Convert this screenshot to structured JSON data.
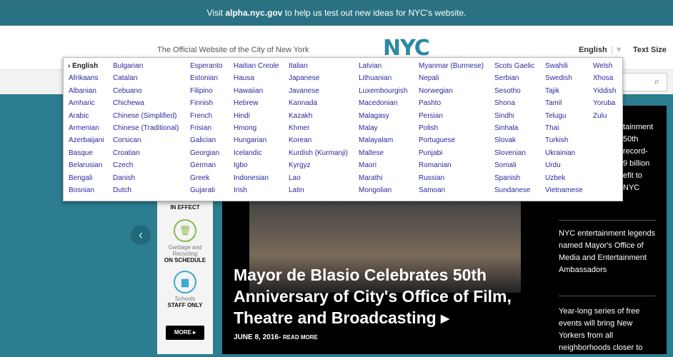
{
  "banner": {
    "pre": "Visit ",
    "link": "alpha.nyc.gov",
    "post": " to help us test out new ideas for NYC's website."
  },
  "header": {
    "tagline": "The Official Website of the City of New York",
    "logo": "NYC",
    "language": "English",
    "text_size": "Text Size"
  },
  "search": {
    "icon": "search-icon"
  },
  "languages": {
    "selected": "English",
    "columns": [
      [
        "English",
        "Afrikaans",
        "Albanian",
        "Amharic",
        "Arabic",
        "Armenian",
        "Azerbaijani",
        "Basque",
        "Belarusian",
        "Bengali",
        "Bosnian"
      ],
      [
        "Bulgarian",
        "Catalan",
        "Cebuano",
        "Chichewa",
        "Chinese (Simplified)",
        "Chinese (Traditional)",
        "Corsican",
        "Croatian",
        "Czech",
        "Danish",
        "Dutch"
      ],
      [
        "Esperanto",
        "Estonian",
        "Filipino",
        "Finnish",
        "French",
        "Frisian",
        "Galician",
        "Georgian",
        "German",
        "Greek",
        "Gujarati"
      ],
      [
        "Haitian Creole",
        "Hausa",
        "Hawaiian",
        "Hebrew",
        "Hindi",
        "Hmong",
        "Hungarian",
        "Icelandic",
        "Igbo",
        "Indonesian",
        "Irish"
      ],
      [
        "Italian",
        "Japanese",
        "Javanese",
        "Kannada",
        "Kazakh",
        "Khmer",
        "Korean",
        "Kurdish (Kurmanji)",
        "Kyrgyz",
        "Lao",
        "Latin"
      ],
      [
        "Latvian",
        "Lithuanian",
        "Luxembourgish",
        "Macedonian",
        "Malagasy",
        "Malay",
        "Malayalam",
        "Maltese",
        "Maori",
        "Marathi",
        "Mongolian"
      ],
      [
        "Myanmar (Burmese)",
        "Nepali",
        "Norwegian",
        "Pashto",
        "Persian",
        "Polish",
        "Portuguese",
        "Punjabi",
        "Romanian",
        "Russian",
        "Samoan"
      ],
      [
        "Scots Gaelic",
        "Serbian",
        "Sesotho",
        "Shona",
        "Sindhi",
        "Sinhala",
        "Slovak",
        "Slovenian",
        "Somali",
        "Spanish",
        "Sundanese"
      ],
      [
        "Swahili",
        "Swedish",
        "Tajik",
        "Tamil",
        "Telugu",
        "Thai",
        "Turkish",
        "Ukrainian",
        "Urdu",
        "Uzbek",
        "Vietnamese"
      ],
      [
        "Welsh",
        "Xhosa",
        "Yiddish",
        "Yoruba",
        "Zulu"
      ]
    ]
  },
  "widget": {
    "status1": "IN EFFECT",
    "garbage_label": "Garbage and Recycling",
    "garbage_status": "ON SCHEDULE",
    "schools_label": "Schools",
    "schools_status": "STAFF ONLY",
    "more": "MORE ▸"
  },
  "hero": {
    "headline": "Mayor de Blasio Celebrates 50th Anniversary of City's Office of Film, Theatre and Broadcasting ▸",
    "date": "JUNE 8, 2016-",
    "read_more": "READ MORE"
  },
  "side": {
    "items": [
      "tainment\n 50th\n record-\n9 billion\nefit to\nNYC",
      "NYC entertainment legends named Mayor's Office of Media and Entertainment Ambassadors",
      "Year-long series of free events will bring New Yorkers from all neighborhoods closer to"
    ]
  },
  "colors": {
    "teal": "#2a7283",
    "logo": "#2a8aa0",
    "link": "#2a2a9a"
  }
}
